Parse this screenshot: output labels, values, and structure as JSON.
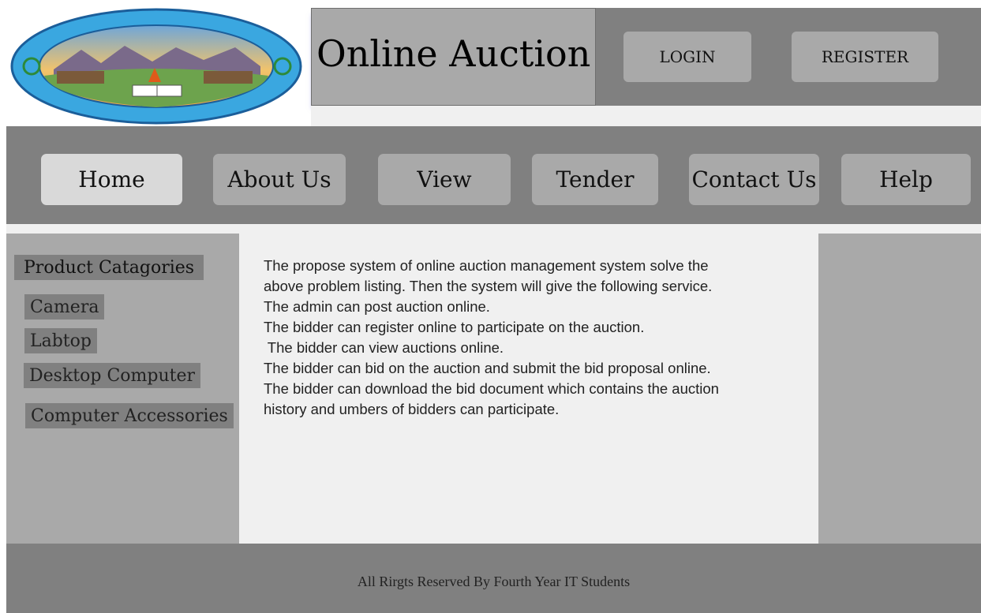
{
  "header": {
    "title": "Online Auction",
    "login_label": "LOGIN",
    "register_label": "REGISTER",
    "logo_name": "wolkite-university-logo"
  },
  "nav": {
    "items": [
      {
        "label": "Home",
        "active": true
      },
      {
        "label": "About Us"
      },
      {
        "label": "View"
      },
      {
        "label": "Tender"
      },
      {
        "label": "Contact Us"
      },
      {
        "label": "Help"
      }
    ]
  },
  "sidebar": {
    "heading": "Product Catagories",
    "categories": [
      "Camera",
      "Labtop",
      "Desktop Computer",
      "Computer Accessories"
    ]
  },
  "content": {
    "lines": [
      "The propose system of online auction management system solve the",
      "above problem listing. Then the system will give the following service.",
      "The admin can post auction online.",
      "The bidder can register online to participate on the auction.",
      " The bidder can view auctions online.",
      "The bidder can bid on the auction and submit the bid proposal online.",
      "The bidder can download the bid document which contains the auction",
      "history and umbers of bidders can participate."
    ]
  },
  "footer": {
    "text": "All Rirgts Reserved By Fourth Year IT Students"
  },
  "colors": {
    "dark_gray": "#808080",
    "mid_gray": "#a9a9a9",
    "light_gray": "#f0f0f0",
    "active_tab": "#d9d9d9"
  }
}
